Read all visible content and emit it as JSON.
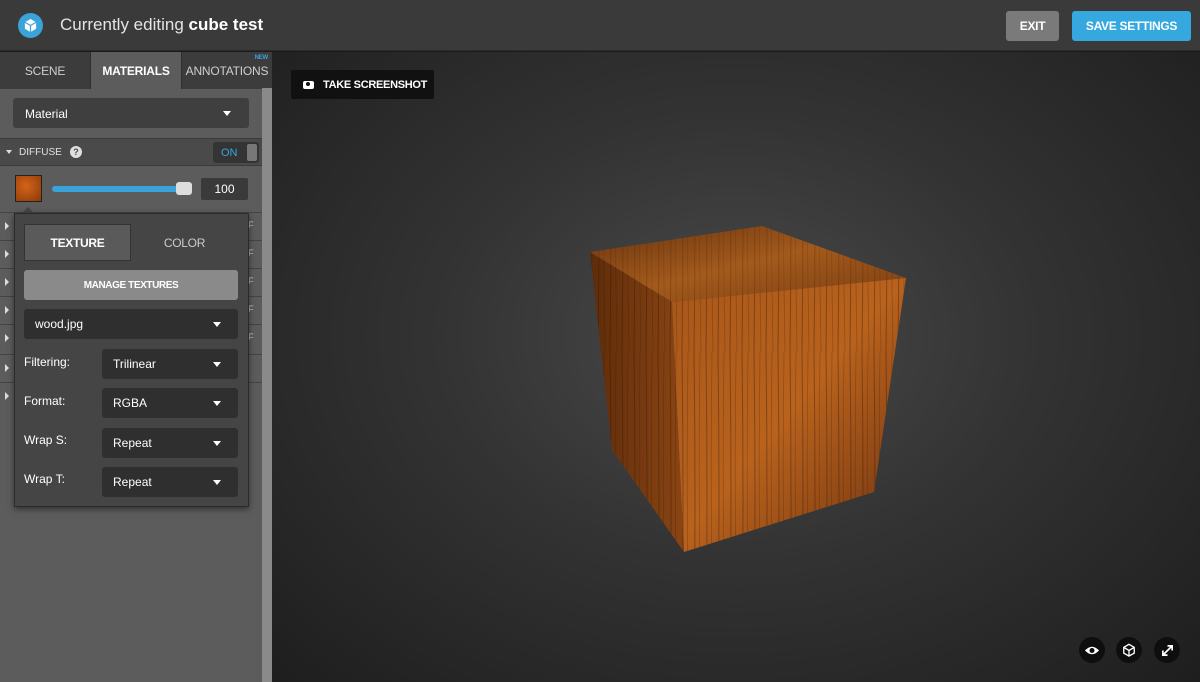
{
  "header": {
    "title_prefix": "Currently editing",
    "title_model": "cube test",
    "exit_label": "EXIT",
    "save_label": "SAVE SETTINGS"
  },
  "tabs": [
    {
      "label": "SCENE"
    },
    {
      "label": "MATERIALS"
    },
    {
      "label": "ANNOTATIONS",
      "badge": "NEW"
    }
  ],
  "material_select": {
    "value": "Material"
  },
  "diffuse": {
    "label": "DIFFUSE",
    "help": "?",
    "toggle": "ON",
    "value": "100",
    "slider_percent": 100
  },
  "collapsed_rows": [
    {
      "suffix": "F"
    },
    {
      "suffix": "F"
    },
    {
      "suffix": "F"
    },
    {
      "suffix": "F"
    },
    {
      "suffix": "F"
    },
    {
      "suffix": ""
    },
    {
      "suffix": ""
    }
  ],
  "popup": {
    "tab_texture": "TEXTURE",
    "tab_color": "COLOR",
    "manage_label": "MANAGE TEXTURES",
    "texture_file": "wood.jpg",
    "filtering_label": "Filtering:",
    "filtering_value": "Trilinear",
    "format_label": "Format:",
    "format_value": "RGBA",
    "wraps_label": "Wrap S:",
    "wraps_value": "Repeat",
    "wrapt_label": "Wrap T:",
    "wrapt_value": "Repeat"
  },
  "viewport": {
    "screenshot_label": "TAKE SCREENSHOT"
  },
  "icons": [
    "app-logo-icon",
    "help-icon",
    "camera-icon",
    "eye-icon",
    "cube-icon",
    "fullscreen-icon"
  ],
  "colors": {
    "accent": "#3aa3d9",
    "topbar": "#3a3a3a",
    "sidebar": "#5c5c5c"
  }
}
